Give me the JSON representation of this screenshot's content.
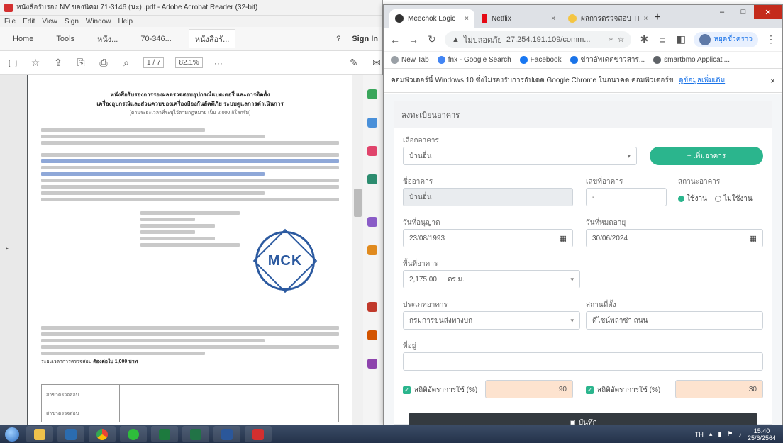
{
  "acrobat": {
    "title": "หนังสือรับรอง NV ของนิคม 71-3146 (นะ) .pdf - Adobe Acrobat Reader (32-bit)",
    "menu": [
      "File",
      "Edit",
      "View",
      "Sign",
      "Window",
      "Help"
    ],
    "tabs": [
      "Home",
      "Tools",
      "หนัง...",
      "70-346...",
      "หนังสือรั..."
    ],
    "sign_in": "Sign In",
    "page_indicator": "1 / 7",
    "zoom": "82.1%",
    "doc": {
      "heading1": "หนังสือรับรองการรองผลตรวจสอบอุปกรณ์แบตเตอรี่ และการติดตั้ง",
      "heading2": "เครื่องอุปกรณ์และส่วนควบของเครื่องป้องกันอัคคีภัย ระบบดูแลการดำเนินการ",
      "sub": "(ตามระยะเวลาที่ระบุไว้ตามกฎหมาย เป็น 2,000 กิโลกรัม)",
      "seal_text": "MCK",
      "footer_label": "ระยะเวลาการตรวจสอบ",
      "footer_value": "ต้องต่อใบ 1,000 บาท",
      "table_rows": [
        "สาขาตรวจสอบ",
        "สาขาตรวจสอบ"
      ]
    }
  },
  "chrome": {
    "tabs": [
      {
        "label": "Meechok Logic",
        "fav_color": "#333333",
        "close": "×"
      },
      {
        "label": "Netflix",
        "fav_color": "#e50914",
        "close": "×"
      },
      {
        "label": "ผลการตรวจสอบ TI",
        "fav_color": "#f4c542",
        "close": "×"
      }
    ],
    "new_tab": "+",
    "url": "27.254.191.109/comm...",
    "security_label": "ไม่ปลอดภัย",
    "profile_label": "หยุดชั่วคราว",
    "bookmarks": [
      {
        "label": "New Tab",
        "color": "#9aa0a6"
      },
      {
        "label": "fnx - Google Search",
        "color": "#4285f4"
      },
      {
        "label": "Facebook",
        "color": "#1877f2"
      },
      {
        "label": "ข่าวอัพเดตข่าวสาร...",
        "color": "#1a73e8"
      },
      {
        "label": "smartbmo Applicati...",
        "color": "#5f6368"
      }
    ],
    "infobar_text": "คอมพิวเตอร์นี้ Windows 10 ซึ่งไม่รองรับการอัปเดต Google Chrome ในอนาคต คอมพิวเตอร์ของคุณอาจต้อง",
    "infobar_link": "ดูข้อมูลเพิ่มเติม",
    "infobar_close": "×",
    "form": {
      "header": "ลงทะเบียนอาคาร",
      "building_type_label": "เลือกอาคาร",
      "building_type_value": "บ้านอื่น",
      "add_building_button": "+ เพิ่มอาคาร",
      "building_name_label": "ชื่ออาคาร",
      "building_name_value": "บ้านอื่น",
      "building_no_label": "เลขที่อาคาร",
      "building_no_value": "-",
      "status_label": "สถานะอาคาร",
      "status_options": [
        "ใช้งาน",
        "ไม่ใช้งาน"
      ],
      "status_selected": 0,
      "start_date_label": "วันที่อนุญาต",
      "start_date_value": "23/08/1993",
      "end_date_label": "วันที่หมดอายุ",
      "end_date_value": "30/06/2024",
      "area_label": "พื้นที่อาคาร",
      "area_value": "2,175.00",
      "area_unit": "ตร.ม.",
      "building_group_label": "ประเภทอาคาร",
      "building_group_value": "กรมการขนส่งทางบก",
      "location_label": "สถานที่ตั้ง",
      "location_value": "ดีไซน์พลาซ่า ถนน",
      "address_label": "ที่อยู่",
      "address_value": "",
      "check1_label": "สถิติอัตราการใช้ (%)",
      "check1_value": "90",
      "check2_label": "สถิติอัตราการใช้ (%)",
      "check2_value": "30",
      "save_button": "บันทึก"
    }
  },
  "taskbar": {
    "apps": [
      {
        "name": "explorer",
        "color": "#f0c24b"
      },
      {
        "name": "store",
        "color": "#2b6cb0"
      },
      {
        "name": "chrome",
        "color": "#ea4335"
      },
      {
        "name": "line",
        "color": "#2ebd3b"
      },
      {
        "name": "excel-green",
        "color": "#1d7a3e"
      },
      {
        "name": "excel",
        "color": "#217346"
      },
      {
        "name": "word",
        "color": "#2b579a"
      },
      {
        "name": "acrobat",
        "color": "#d32f2f"
      }
    ],
    "language": "TH",
    "time": "15:40",
    "date": "25/6/2564"
  }
}
